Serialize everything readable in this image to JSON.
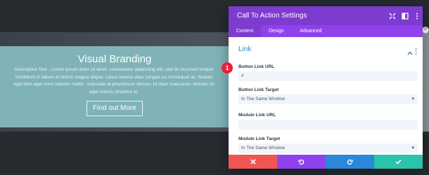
{
  "hero": {
    "title": "Visual Branding",
    "description": "Descriptive Text : Lorem ipsum dolor sit amet, consectetur adipiscing elit, sed do eiusmod tempor incididunt ut labore et dolore magna aliqua. Lacus viverra vitae congue eu consequat ac. Nullam eget felis eget nunc lobortis mattis. Vulputate at pharetra et ultrices. Id diam maecenas ultricies mi eget mauris pharetra et.",
    "button_label": "Find out More"
  },
  "modal": {
    "title": "Call To Action Settings",
    "tabs": [
      {
        "label": "Content",
        "active": true
      },
      {
        "label": "Design",
        "active": false
      },
      {
        "label": "Advanced",
        "active": false
      }
    ],
    "section_title": "Link",
    "fields": {
      "button_link_url": {
        "label": "Button Link URL",
        "value": "#"
      },
      "button_link_target": {
        "label": "Button Link Target",
        "value": "In The Same Window"
      },
      "module_link_url": {
        "label": "Module Link URL",
        "value": ""
      },
      "module_link_target": {
        "label": "Module Link Target",
        "value": "In The Same Window"
      }
    },
    "footer_buttons": [
      "close-icon",
      "undo-icon",
      "redo-icon",
      "check-icon"
    ]
  },
  "badge": "1",
  "colors": {
    "header_purple": "#7e3bd0",
    "tabs_purple": "#8f42ec",
    "section_blue": "#2e8ac2",
    "cancel_red": "#ef5555",
    "undo_purple": "#8f42ec",
    "redo_blue": "#2b87da",
    "save_green": "#29c4a9",
    "cta_teal": "#7fb3b8"
  }
}
